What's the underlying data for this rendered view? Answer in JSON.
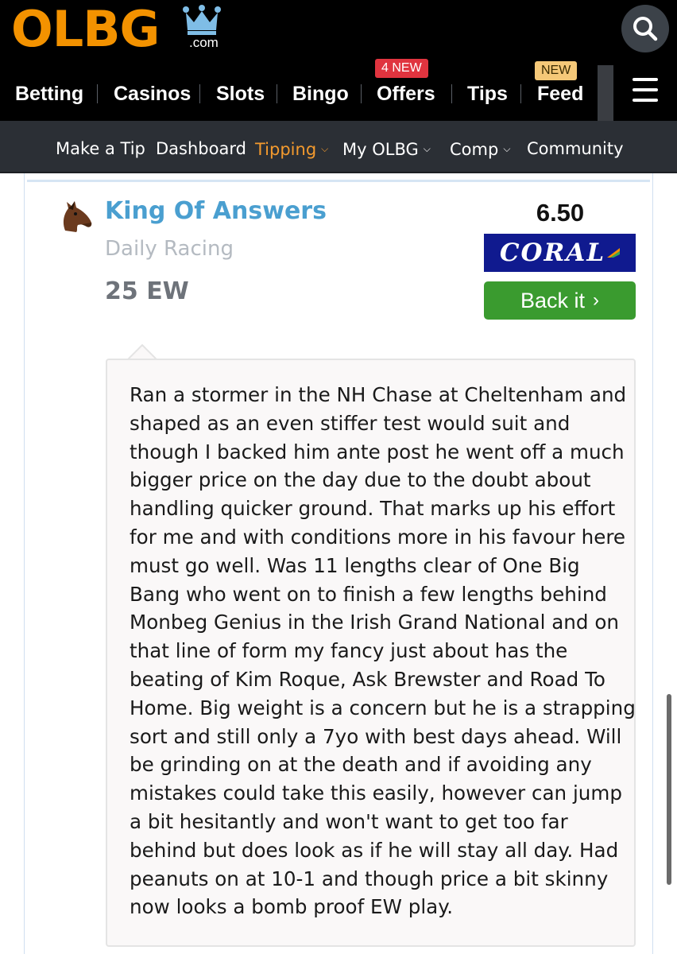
{
  "header": {
    "logo_text": "OLBG",
    "logo_suffix": ".com",
    "brand_color": "#f39200",
    "search_icon": "search-icon",
    "menu_icon": "hamburger-menu-icon"
  },
  "main_nav": {
    "items": [
      {
        "label": "Betting"
      },
      {
        "label": "Casinos"
      },
      {
        "label": "Slots"
      },
      {
        "label": "Bingo"
      },
      {
        "label": "Offers",
        "badge": "4 NEW"
      },
      {
        "label": "Tips"
      },
      {
        "label": "Feed",
        "badge": "NEW"
      }
    ]
  },
  "sub_nav": {
    "items": [
      {
        "label": "Make a Tip"
      },
      {
        "label": "Dashboard"
      },
      {
        "label": "Tipping",
        "dropdown": true,
        "active": true
      },
      {
        "label": "My OLBG",
        "dropdown": true
      },
      {
        "label": "Comp",
        "dropdown": true
      },
      {
        "label": "Community"
      }
    ],
    "active_color": "#f39a2e"
  },
  "tip": {
    "avatar_icon": "horse-head-icon",
    "horse_name": "King Of Answers",
    "category": "Daily Racing",
    "stake": "25 EW",
    "odds": "6.50",
    "bookmaker": "CORAL",
    "bookmaker_color": "#101a8f",
    "back_label": "Back it",
    "back_color": "#3a9b2f",
    "comment_lines": [
      "Ran a stormer in the NH Chase at Cheltenham and",
      "shaped as an even stiffer test would suit and",
      "though I backed him ante post he went off a much",
      "bigger price on the day due to the doubt about",
      "handling quicker ground. That marks up his effort",
      "for me and with conditions more in his favour here",
      "must go well. Was 11 lengths clear of One Big",
      "Bang who went on to finish a few lengths behind",
      "Monbeg Genius in the Irish Grand National and on",
      "that line of form my fancy just about has the",
      "beating of Kim Roque, Ask Brewster and Road To",
      "Home. Big weight is a concern but he is a strapping",
      "sort and still only a 7yo with best days ahead. Will",
      "be grinding on at the death and if avoiding any",
      "mistakes could take this easily, however can jump",
      "a bit hesitantly and won't want to get too far",
      "behind but does look as if he will stay all day. Had",
      "peanuts on at 10-1 and though price a bit skinny",
      "now looks a bomb proof EW play."
    ]
  }
}
